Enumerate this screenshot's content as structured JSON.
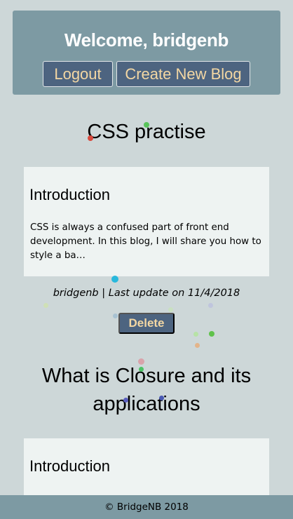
{
  "header": {
    "welcome": "Welcome, bridgenb",
    "logout_label": "Logout",
    "create_label": "Create New Blog"
  },
  "blogs": [
    {
      "title": "CSS practise",
      "section": "Introduction",
      "excerpt": "CSS is always a confused part of front end development. In this blog, I will share you how to style a ba…",
      "meta": "bridgenb | Last update on 11/4/2018",
      "delete_label": "Delete"
    },
    {
      "title": "What is Closure and its applications",
      "section": "Introduction",
      "excerpt": ""
    }
  ],
  "footer": {
    "text": "© BridgeNB 2018"
  },
  "colors": {
    "background": "#cdd7d8",
    "header": "#7d9aa3",
    "button": "#4d6480",
    "button_text": "#f3d7a3",
    "card": "#eef3f2"
  }
}
